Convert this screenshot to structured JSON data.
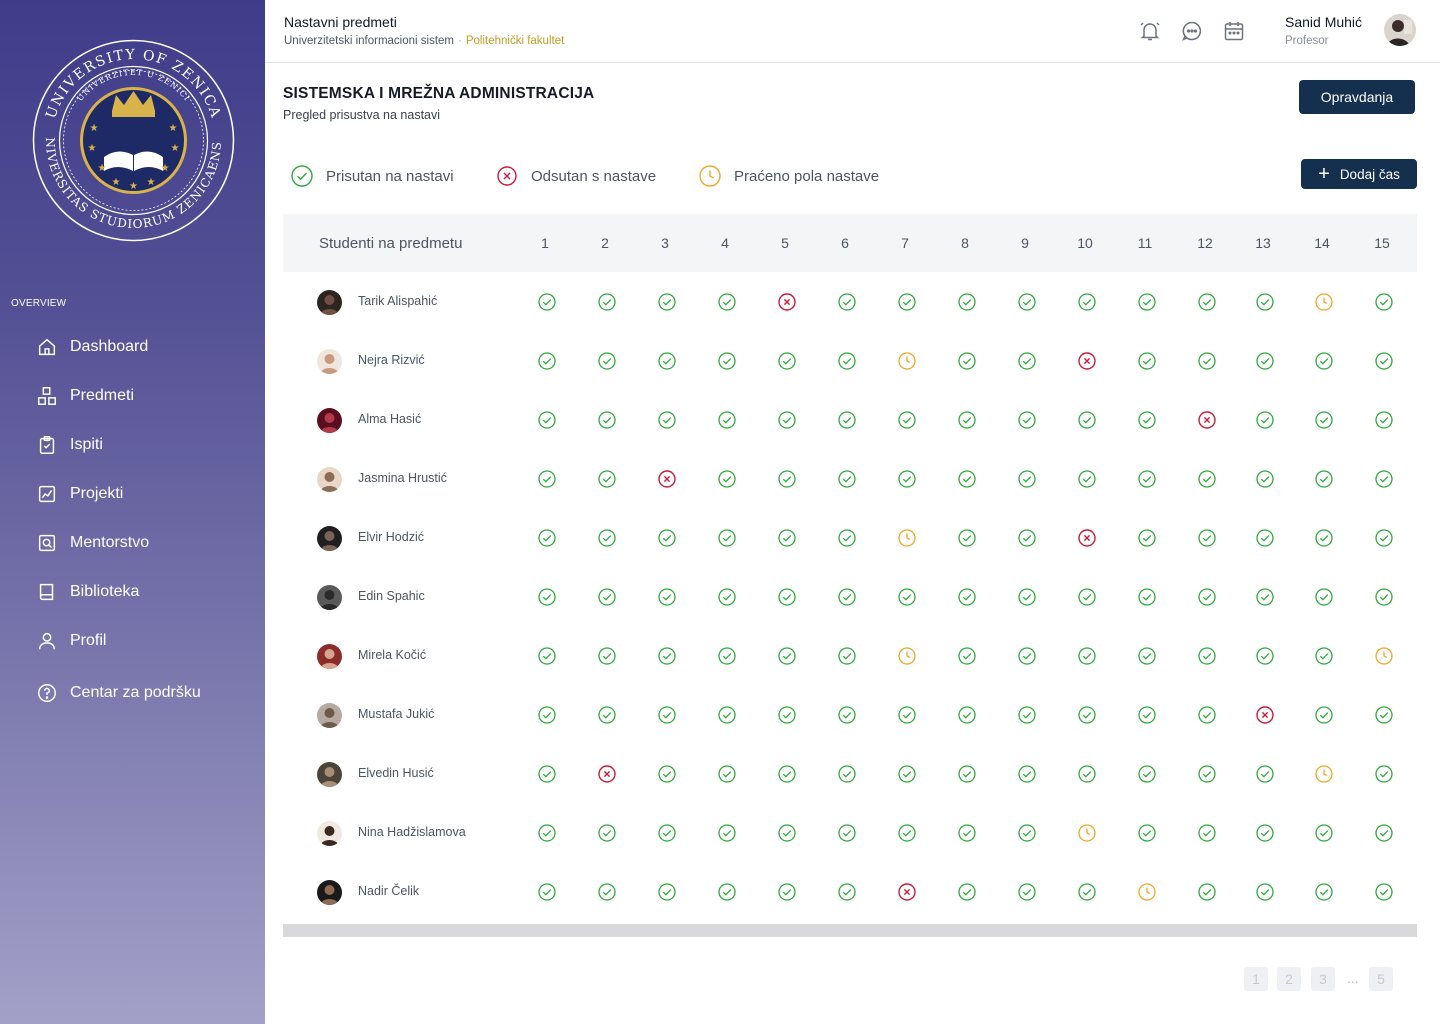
{
  "colors": {
    "present": "#2eaa3b",
    "absent": "#cc1b3a",
    "half": "#f1a624",
    "primary_button": "#15304f",
    "sidebar_top": "#3f3d8a",
    "sidebar_bottom": "#a3a0c8",
    "accent_text": "#c49a25"
  },
  "sidebar": {
    "logo": {
      "outer_text": "UNIVERSITY OF ZENICA",
      "inner_text": "UNIVERZITET U ZENICI",
      "bottom_text": "UNIVERSITAS STUDIORUM ZENICAENSIS"
    },
    "section_label": "OVERVIEW",
    "items": [
      {
        "label": "Dashboard",
        "icon": "home-icon"
      },
      {
        "label": "Predmeti",
        "icon": "blocks-icon"
      },
      {
        "label": "Ispiti",
        "icon": "clipboard-check-icon"
      },
      {
        "label": "Projekti",
        "icon": "chart-doc-icon"
      },
      {
        "label": "Mentorstvo",
        "icon": "search-doc-icon"
      },
      {
        "label": "Biblioteka",
        "icon": "book-icon"
      },
      {
        "label": "Profil",
        "icon": "user-icon"
      },
      {
        "label": "Centar za podršku",
        "icon": "help-circle-icon"
      }
    ]
  },
  "header": {
    "title": "Nastavni predmeti",
    "breadcrumb": "Univerzitetski informacioni sistem",
    "faculty": "Politehnički fakultet",
    "icons": [
      "bell-icon",
      "chat-icon",
      "calendar-icon"
    ],
    "user_name": "Sanid Muhić",
    "user_role": "Profesor"
  },
  "course": {
    "title": "SISTEMSKA I MREŽNA ADMINISTRACIJA",
    "subtitle": "Pregled prisustva na nastavi",
    "justify_button": "Opravdanja",
    "add_button": "Dodaj čas"
  },
  "legend": {
    "present": "Prisutan na nastavi",
    "absent": "Odsutan s  nastave",
    "half": "Praćeno pola nastave"
  },
  "table": {
    "name_header": "Studenti na predmetu",
    "columns": [
      "1",
      "2",
      "3",
      "4",
      "5",
      "6",
      "7",
      "8",
      "9",
      "10",
      "11",
      "12",
      "13",
      "14",
      "15"
    ],
    "rows": [
      {
        "name": "Tarik Alispahić",
        "status": "PPPPAPPPPPPPPHP"
      },
      {
        "name": "Nejra Rizvić",
        "status": "PPPPPPHPPAPPPPP"
      },
      {
        "name": "Alma Hasić",
        "status": "PPPPPPPPPPPAPPP"
      },
      {
        "name": "Jasmina Hrustić",
        "status": "PPAPPPPPPPPPPPP"
      },
      {
        "name": "Elvir Hodzić",
        "status": "PPPPPPHPPAPPPPP"
      },
      {
        "name": "Edin Spahic",
        "status": "PPPPPPPPPPPPPPP"
      },
      {
        "name": "Mirela Kočić",
        "status": "PPPPPPHPPPPPPPH"
      },
      {
        "name": "Mustafa Jukić",
        "status": "PPPPPPPPPPPPAPP"
      },
      {
        "name": "Elvedin Husić",
        "status": "PAPPPPPPPPPPPHP"
      },
      {
        "name": "Nina Hadžislamova",
        "status": "PPPPPPPPPHPPPPP"
      },
      {
        "name": "Nadir Čelik",
        "status": "PPPPPPAPPPHPPPP"
      }
    ]
  },
  "pagination": {
    "pages": [
      "1",
      "2",
      "3",
      "5"
    ],
    "ellipsis": "..."
  }
}
